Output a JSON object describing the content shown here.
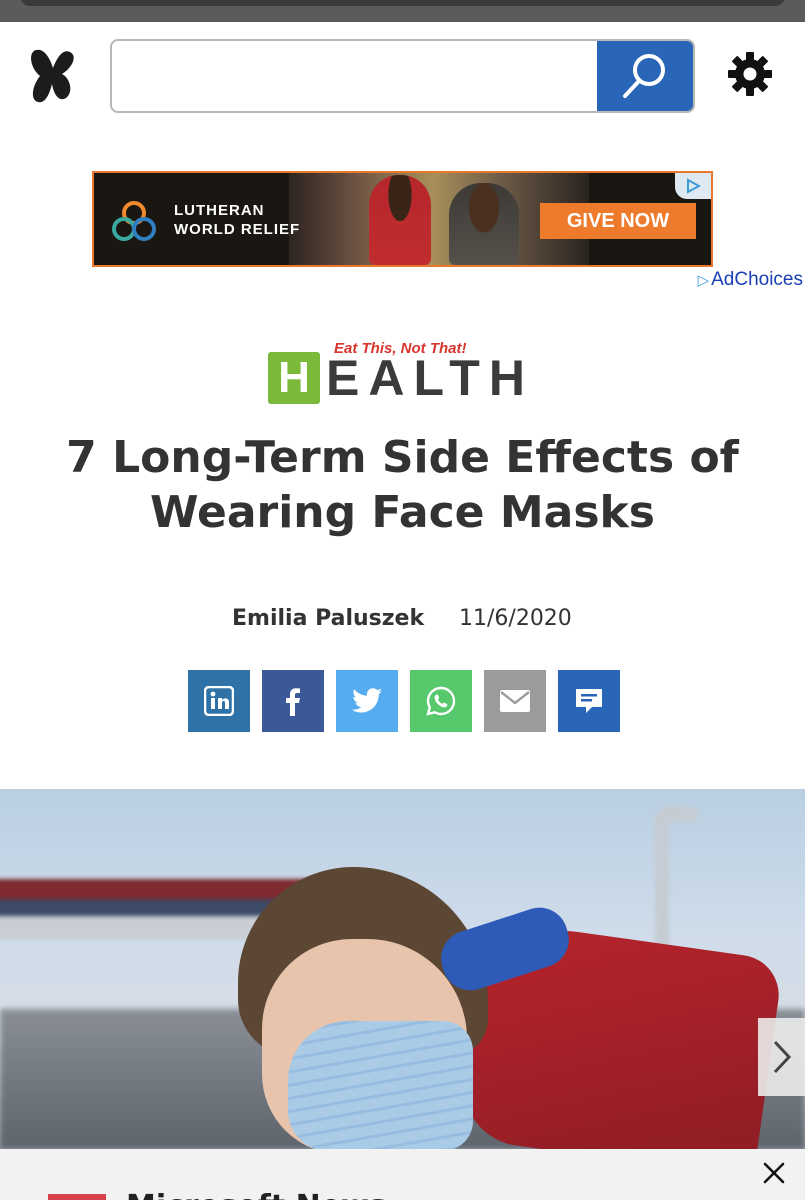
{
  "header": {
    "search_placeholder": "",
    "search_value": ""
  },
  "ad": {
    "brand_line1": "LUTHERAN",
    "brand_line2": "WORLD RELIEF",
    "cta": "GIVE NOW",
    "adchoices": "AdChoices"
  },
  "brand": {
    "tagline": "Eat This, Not That!",
    "letter": "H",
    "word": "EALTH",
    "colors": {
      "green": "#7ab93a",
      "red": "#d9362f"
    }
  },
  "article": {
    "title": "7 Long-Term Side Effects of Wearing Face Masks",
    "author": "Emilia Paluszek",
    "date": "11/6/2020"
  },
  "share": [
    {
      "name": "linkedin",
      "color": "#2e72a8"
    },
    {
      "name": "facebook",
      "color": "#3b5998"
    },
    {
      "name": "twitter",
      "color": "#55acee"
    },
    {
      "name": "whatsapp",
      "color": "#57c86b"
    },
    {
      "name": "email",
      "color": "#9b9b9b"
    },
    {
      "name": "comments",
      "color": "#2a66b8"
    }
  ],
  "bottom_bar": {
    "title_fragment": "Microsoft News"
  },
  "colors": {
    "accent_blue": "#2a66b8",
    "ad_orange": "#ee7a2c"
  }
}
